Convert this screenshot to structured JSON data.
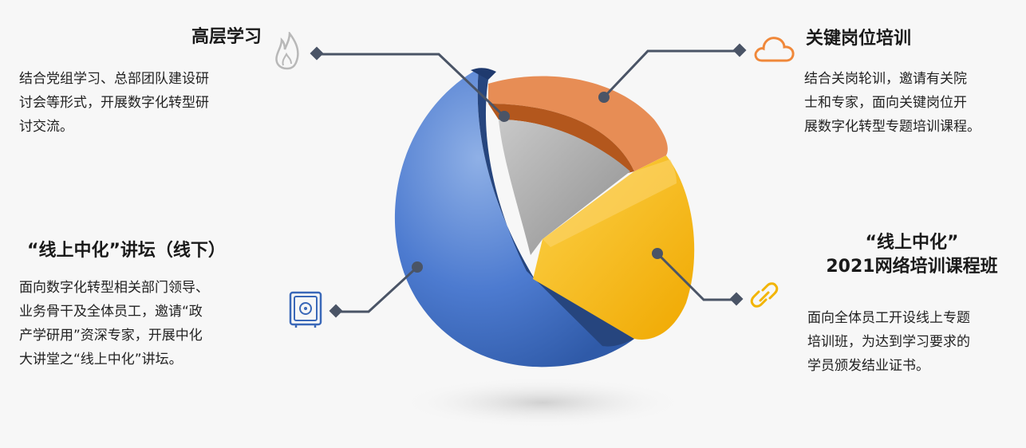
{
  "blocks": {
    "top_left": {
      "title": "高层学习",
      "lines": [
        "结合党组学习、总部团队建设研",
        "讨会等形式，开展数字化转型研",
        "讨交流。"
      ]
    },
    "top_right": {
      "title": "关键岗位培训",
      "lines": [
        "结合关岗轮训，邀请有关院",
        "士和专家，面向关键岗位开",
        "展数字化转型专题培训课程。"
      ]
    },
    "bottom_left": {
      "title": "“线上中化”讲坛（线下）",
      "lines": [
        "面向数字化转型相关部门领导、",
        "业务骨干及全体员工，邀请“政",
        "产学研用”资深专家，开展中化",
        "大讲堂之“线上中化”讲坛。"
      ]
    },
    "bottom_right": {
      "title_line1": "“线上中化”",
      "title_line2": "2021网络培训课程班",
      "lines": [
        "面向全体员工开设线上专题",
        "培训班，为达到学习要求的",
        "学员颁发结业证书。"
      ]
    }
  },
  "icons": {
    "top_left": "flame-icon",
    "top_right": "cloud-icon",
    "bottom_left": "safe-icon",
    "bottom_right": "link-icon"
  },
  "colors": {
    "blue": "#4a78c8",
    "dark_blue": "#2a4a86",
    "orange": "#e8874a",
    "dark_orange": "#b9551a",
    "yellow": "#f6b91a",
    "gray": "#a9a9a9",
    "connector": "#4a5466"
  }
}
